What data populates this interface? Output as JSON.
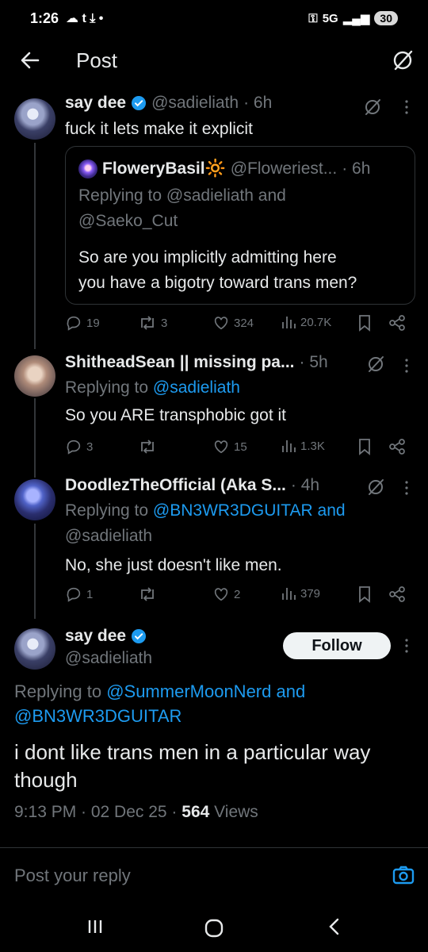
{
  "status_bar": {
    "time": "1:26",
    "network": "5G",
    "battery": "30"
  },
  "header": {
    "title": "Post"
  },
  "tweets": [
    {
      "name": "say dee",
      "handle": "@sadieliath",
      "time": "· 6h",
      "text": "fuck it lets make it explicit",
      "quote": {
        "name": "FloweryBasil🔆",
        "handle": "@Floweriest...",
        "time": "· 6h",
        "replying_line1": "Replying to @sadieliath and",
        "replying_line2": "@Saeko_Cut",
        "text_line1": "So are you implicitly admitting here",
        "text_line2": "you have a bigotry toward trans men?"
      },
      "stats": {
        "replies": "19",
        "reposts": "3",
        "likes": "324",
        "views": "20.7K"
      }
    },
    {
      "name": "ShitheadSean || missing pa...",
      "time": "· 5h",
      "replying_prefix": "Replying to ",
      "replying_to": "@sadieliath",
      "text": "So you ARE transphobic got it",
      "stats": {
        "replies": "3",
        "reposts": "",
        "likes": "15",
        "views": "1.3K"
      }
    },
    {
      "name": "DoodlezTheOfficial (Aka S...",
      "time": "· 4h",
      "replying_prefix": "Replying to ",
      "replying_to_line1": "@BN3WR3DGUITAR and",
      "replying_to_line2": "@sadieliath",
      "text": "No, she just doesn't like men.",
      "stats": {
        "replies": "1",
        "reposts": "",
        "likes": "2",
        "views": "379"
      }
    }
  ],
  "main_tweet": {
    "name": "say dee",
    "handle": "@sadieliath",
    "follow_label": "Follow",
    "replying_prefix": "Replying to ",
    "replying_to_line1": "@SummerMoonNerd and",
    "replying_to_line2": "@BN3WR3DGUITAR",
    "text_line1": "i dont like trans men in a particular way",
    "text_line2": "though",
    "time": "9:13 PM · 02 Dec 25 · ",
    "views_count": "564",
    "views_label": " Views"
  },
  "reply_bar": {
    "placeholder": "Post your reply"
  },
  "colors": {
    "background": "#000000",
    "text": "#e7e9ea",
    "muted": "#71767b",
    "accent": "#1d9bf0",
    "border": "#2f3336"
  },
  "icons": [
    "back-arrow-icon",
    "grok-icon",
    "verified-icon",
    "more-icon",
    "reply-icon",
    "repost-icon",
    "like-icon",
    "views-icon",
    "bookmark-icon",
    "share-icon",
    "camera-icon",
    "recents-icon",
    "home-icon",
    "nav-back-icon"
  ]
}
